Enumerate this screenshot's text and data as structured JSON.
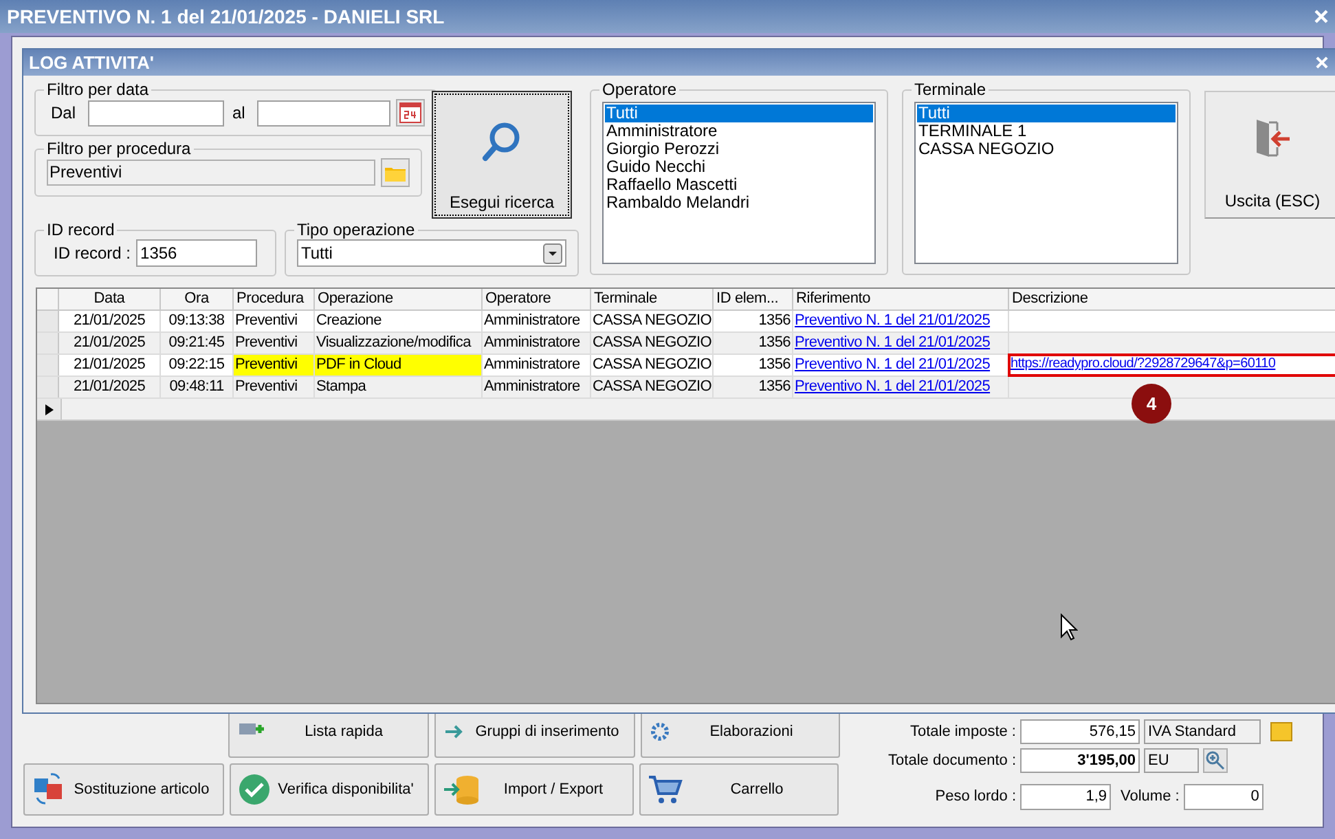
{
  "main_window": {
    "title": "PREVENTIVO N. 1 del 21/01/2025 - DANIELI SRL"
  },
  "dialog": {
    "title": "LOG ATTIVITA'",
    "date_filter": {
      "label": "Filtro per data",
      "from_label": "Dal",
      "to_label": "al"
    },
    "procedure_filter": {
      "label": "Filtro per procedura",
      "value": "Preventivi"
    },
    "id_record": {
      "label": "ID record",
      "field_label": "ID record :",
      "value": "1356"
    },
    "operation_type": {
      "label": "Tipo operazione",
      "value": "Tutti"
    },
    "search_button": "Esegui ricerca",
    "operators": {
      "label": "Operatore",
      "items": [
        {
          "label": "Tutti",
          "selected": true
        },
        {
          "label": "Amministratore",
          "selected": false
        },
        {
          "label": "Giorgio Perozzi",
          "selected": false
        },
        {
          "label": "Guido Necchi",
          "selected": false
        },
        {
          "label": "Raffaello Mascetti",
          "selected": false
        },
        {
          "label": "Rambaldo Melandri",
          "selected": false
        }
      ]
    },
    "terminals": {
      "label": "Terminale",
      "items": [
        {
          "label": "Tutti",
          "selected": true
        },
        {
          "label": "TERMINALE 1",
          "selected": false
        },
        {
          "label": "CASSA NEGOZIO",
          "selected": false
        }
      ]
    },
    "exit_button": "Uscita (ESC)",
    "table": {
      "columns": [
        "Data",
        "Ora",
        "Procedura",
        "Operazione",
        "Operatore",
        "Terminale",
        "ID elem...",
        "Riferimento",
        "Descrizione"
      ],
      "rows": [
        {
          "cells": [
            "21/01/2025",
            "09:13:38",
            "Preventivi",
            "Creazione",
            "Amministratore",
            "CASSA NEGOZIO",
            "1356",
            "Preventivo N. 1 del 21/01/2025"
          ],
          "highlighted": false
        },
        {
          "cells": [
            "21/01/2025",
            "09:21:45",
            "Preventivi",
            "Visualizzazione/modifica",
            "Amministratore",
            "CASSA NEGOZIO",
            "1356",
            "Preventivo N. 1 del 21/01/2025"
          ],
          "highlighted": false
        },
        {
          "cells": [
            "21/01/2025",
            "09:22:15",
            "Preventivi",
            "PDF in Cloud",
            "Amministratore",
            "CASSA NEGOZIO",
            "1356",
            "Preventivo N. 1 del 21/01/2025",
            "https://readypro.cloud/?2928729647&p=60110"
          ],
          "highlighted": true,
          "description_outlined": true
        },
        {
          "cells": [
            "21/01/2025",
            "09:48:11",
            "Preventivi",
            "Stampa",
            "Amministratore",
            "CASSA NEGOZIO",
            "1356",
            "Preventivo N. 1 del 21/01/2025"
          ],
          "highlighted": false
        }
      ]
    },
    "callout": "4"
  },
  "background": {
    "buttons_row1": [
      "Lista rapida",
      "Gruppi di inserimento",
      "Elaborazioni"
    ],
    "buttons_row2": [
      "Sostituzione articolo",
      "Verifica disponibilita'",
      "Import / Export",
      "Carrello"
    ],
    "tax_label": "Totale imposte :",
    "tax_value": "576,15",
    "vat": "IVA Standard",
    "total_label": "Totale documento :",
    "total_value": "3'195,00",
    "currency": "EU",
    "weight_label": "Peso lordo :",
    "weight_value": "1,9",
    "volume_label": "Volume :",
    "volume_value": "0"
  }
}
